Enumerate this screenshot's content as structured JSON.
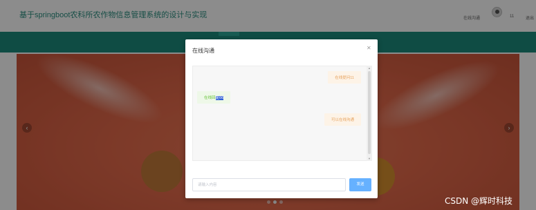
{
  "header": {
    "site_title": "基于springboot农科所农作物信息管理系统的设计与实现",
    "chat_link": "在线沟通",
    "user": "11",
    "logout": "退出"
  },
  "banner": {
    "prev_icon": "chevron-left-icon",
    "next_icon": "chevron-right-icon",
    "slide_count": 3,
    "active_slide": 2
  },
  "dialog": {
    "title": "在线沟通",
    "close_icon": "close-icon",
    "messages": [
      {
        "side": "right",
        "text": "在线提问11"
      },
      {
        "side": "left",
        "text_plain": "在线回",
        "text_highlight": "复66"
      },
      {
        "side": "right",
        "text": "可以在线沟通"
      }
    ],
    "input_placeholder": "请输入内容",
    "send_label": "发送"
  },
  "colors": {
    "teal": "#1c8a7d",
    "send_button": "#66b1ff",
    "question_text": "#e6a15c",
    "answer_text": "#67c23a"
  },
  "watermark": "CSDN @辉时科技"
}
